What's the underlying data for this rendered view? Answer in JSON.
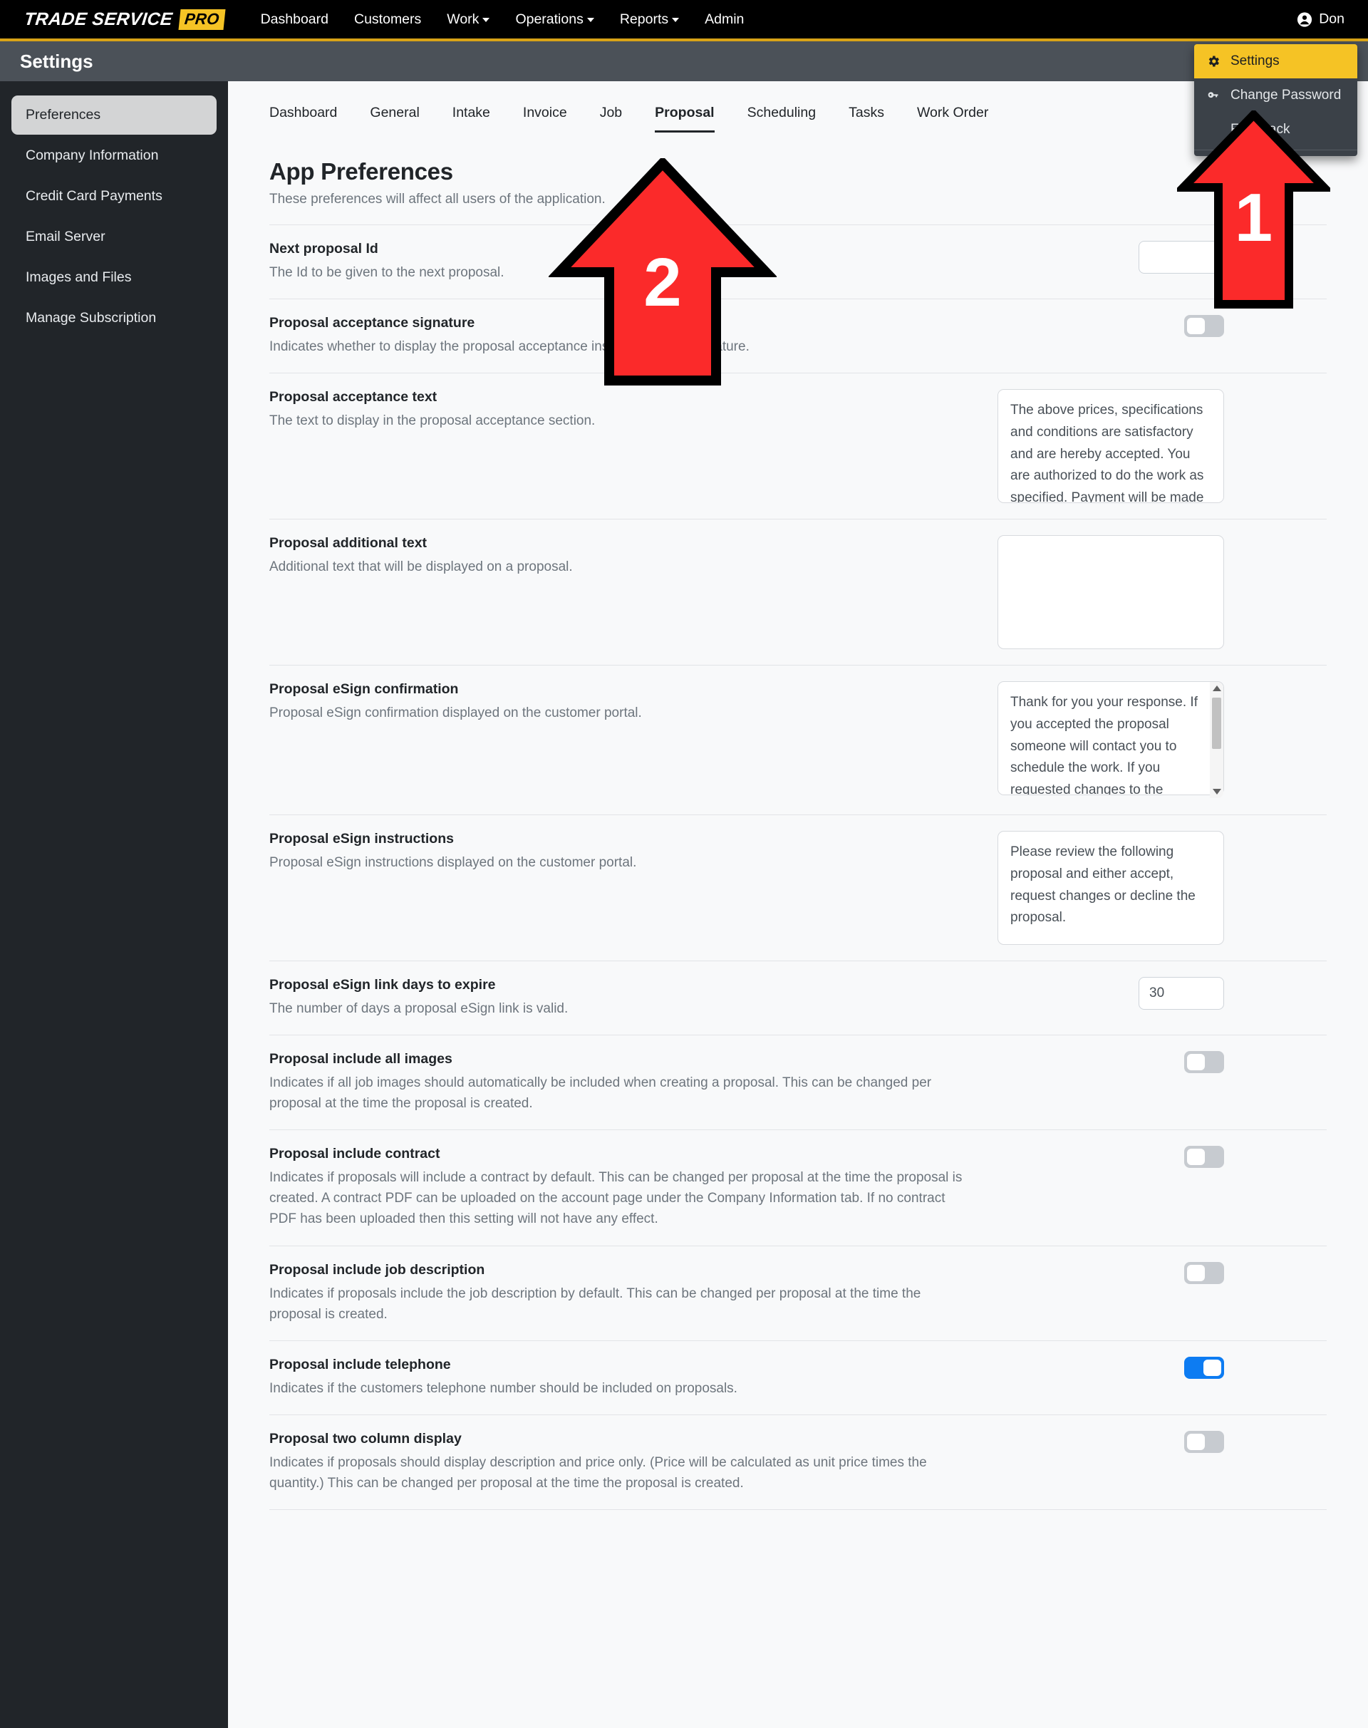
{
  "brand": {
    "name": "TRADE SERVICE",
    "badge": "PRO"
  },
  "topnav": {
    "links": [
      {
        "label": "Dashboard",
        "has_caret": false
      },
      {
        "label": "Customers",
        "has_caret": false
      },
      {
        "label": "Work",
        "has_caret": true
      },
      {
        "label": "Operations",
        "has_caret": true
      },
      {
        "label": "Reports",
        "has_caret": true
      },
      {
        "label": "Admin",
        "has_caret": false
      }
    ],
    "user": {
      "name": "Don",
      "icon": "account-circle-icon"
    }
  },
  "user_dropdown": {
    "items": [
      {
        "label": "Settings",
        "icon": "gear-icon",
        "active": true
      },
      {
        "label": "Change Password",
        "icon": "key-icon",
        "active": false
      },
      {
        "label": "Feedback",
        "icon": "",
        "active": false
      }
    ]
  },
  "subheader": {
    "title": "Settings"
  },
  "sidebar": {
    "items": [
      {
        "label": "Preferences",
        "active": true
      },
      {
        "label": "Company Information",
        "active": false
      },
      {
        "label": "Credit Card Payments",
        "active": false
      },
      {
        "label": "Email Server",
        "active": false
      },
      {
        "label": "Images and Files",
        "active": false
      },
      {
        "label": "Manage Subscription",
        "active": false
      }
    ]
  },
  "tabs": [
    {
      "label": "Dashboard",
      "active": false
    },
    {
      "label": "General",
      "active": false
    },
    {
      "label": "Intake",
      "active": false
    },
    {
      "label": "Invoice",
      "active": false
    },
    {
      "label": "Job",
      "active": false
    },
    {
      "label": "Proposal",
      "active": true
    },
    {
      "label": "Scheduling",
      "active": false
    },
    {
      "label": "Tasks",
      "active": false
    },
    {
      "label": "Work Order",
      "active": false
    }
  ],
  "main": {
    "title": "App Preferences",
    "subtitle": "These preferences will affect all users of the application.",
    "preferences": [
      {
        "name": "Next proposal Id",
        "description": "The Id to be given to the next proposal.",
        "control": "input",
        "value": ""
      },
      {
        "name": "Proposal acceptance signature",
        "description": "Indicates whether to display the proposal acceptance instructions and signature.",
        "control": "toggle",
        "value": "off"
      },
      {
        "name": "Proposal acceptance text",
        "description": "The text to display in the proposal acceptance section.",
        "control": "textarea",
        "value": "The above prices, specifications and conditions are satisfactory and are hereby accepted. You are authorized to do the work as specified. Payment will be made as outlined above."
      },
      {
        "name": "Proposal additional text",
        "description": "Additional text that will be displayed on a proposal.",
        "control": "textarea",
        "value": ""
      },
      {
        "name": "Proposal eSign confirmation",
        "description": "Proposal eSign confirmation displayed on the customer portal.",
        "control": "textarea-scroll",
        "value": "Thank for you your response. If you accepted the proposal someone will contact you to schedule the work. If you requested changes to the proposal either someone will contact you to discuss those changes or an updated"
      },
      {
        "name": "Proposal eSign instructions",
        "description": "Proposal eSign instructions displayed on the customer portal.",
        "control": "textarea",
        "value": "Please review the following proposal and either accept, request changes or decline the proposal."
      },
      {
        "name": "Proposal eSign link days to expire",
        "description": "The number of days a proposal eSign link is valid.",
        "control": "input",
        "value": "30"
      },
      {
        "name": "Proposal include all images",
        "description": "Indicates if all job images should automatically be included when creating a proposal. This can be changed per proposal at the time the proposal is created.",
        "control": "toggle",
        "value": "off"
      },
      {
        "name": "Proposal include contract",
        "description": "Indicates if proposals will include a contract by default. This can be changed per proposal at the time the proposal is created. A contract PDF can be uploaded on the account page under the Company Information tab. If no contract PDF has been uploaded then this setting will not have any effect.",
        "control": "toggle",
        "value": "off"
      },
      {
        "name": "Proposal include job description",
        "description": "Indicates if proposals include the job description by default. This can be changed per proposal at the time the proposal is created.",
        "control": "toggle",
        "value": "off"
      },
      {
        "name": "Proposal include telephone",
        "description": "Indicates if the customers telephone number should be included on proposals.",
        "control": "toggle",
        "value": "on"
      },
      {
        "name": "Proposal two column display",
        "description": "Indicates if proposals should display description and price only. (Price will be calculated as unit price times the quantity.) This can be changed per proposal at the time the proposal is created.",
        "control": "toggle",
        "value": "off"
      }
    ]
  },
  "annotations": [
    {
      "number": "1",
      "color": "#FB2A2A"
    },
    {
      "number": "2",
      "color": "#FB2A2A"
    }
  ],
  "colors": {
    "brand_yellow": "#f5c325",
    "nav_black": "#000000",
    "subheader_gray": "#4b5158",
    "sidebar_dark": "#212529",
    "toggle_on_blue": "#0d7cf2",
    "annotation_red": "#FB2A2A"
  }
}
